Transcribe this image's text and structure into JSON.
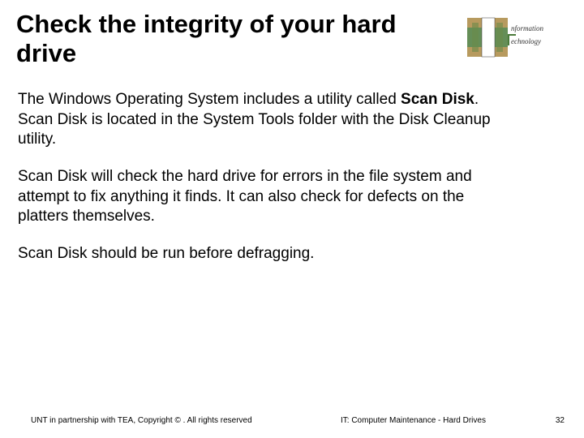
{
  "title": "Check the integrity of your hard drive",
  "para1_pre": "The Windows Operating System includes a utility called ",
  "para1_bold": "Scan Disk",
  "para1_post": ".  Scan Disk is located in the System Tools folder with the Disk Cleanup utility.",
  "para2": "Scan Disk will check the hard drive for errors in the file system and attempt to fix anything it finds. It can also check for defects on the platters themselves.",
  "para3": "Scan Disk should be run before defragging.",
  "footer": {
    "left": "UNT in partnership with TEA, Copyright © . All rights reserved",
    "center": "IT: Computer Maintenance -  Hard Drives",
    "page": "32"
  },
  "logo": {
    "name": "Information Technology"
  }
}
